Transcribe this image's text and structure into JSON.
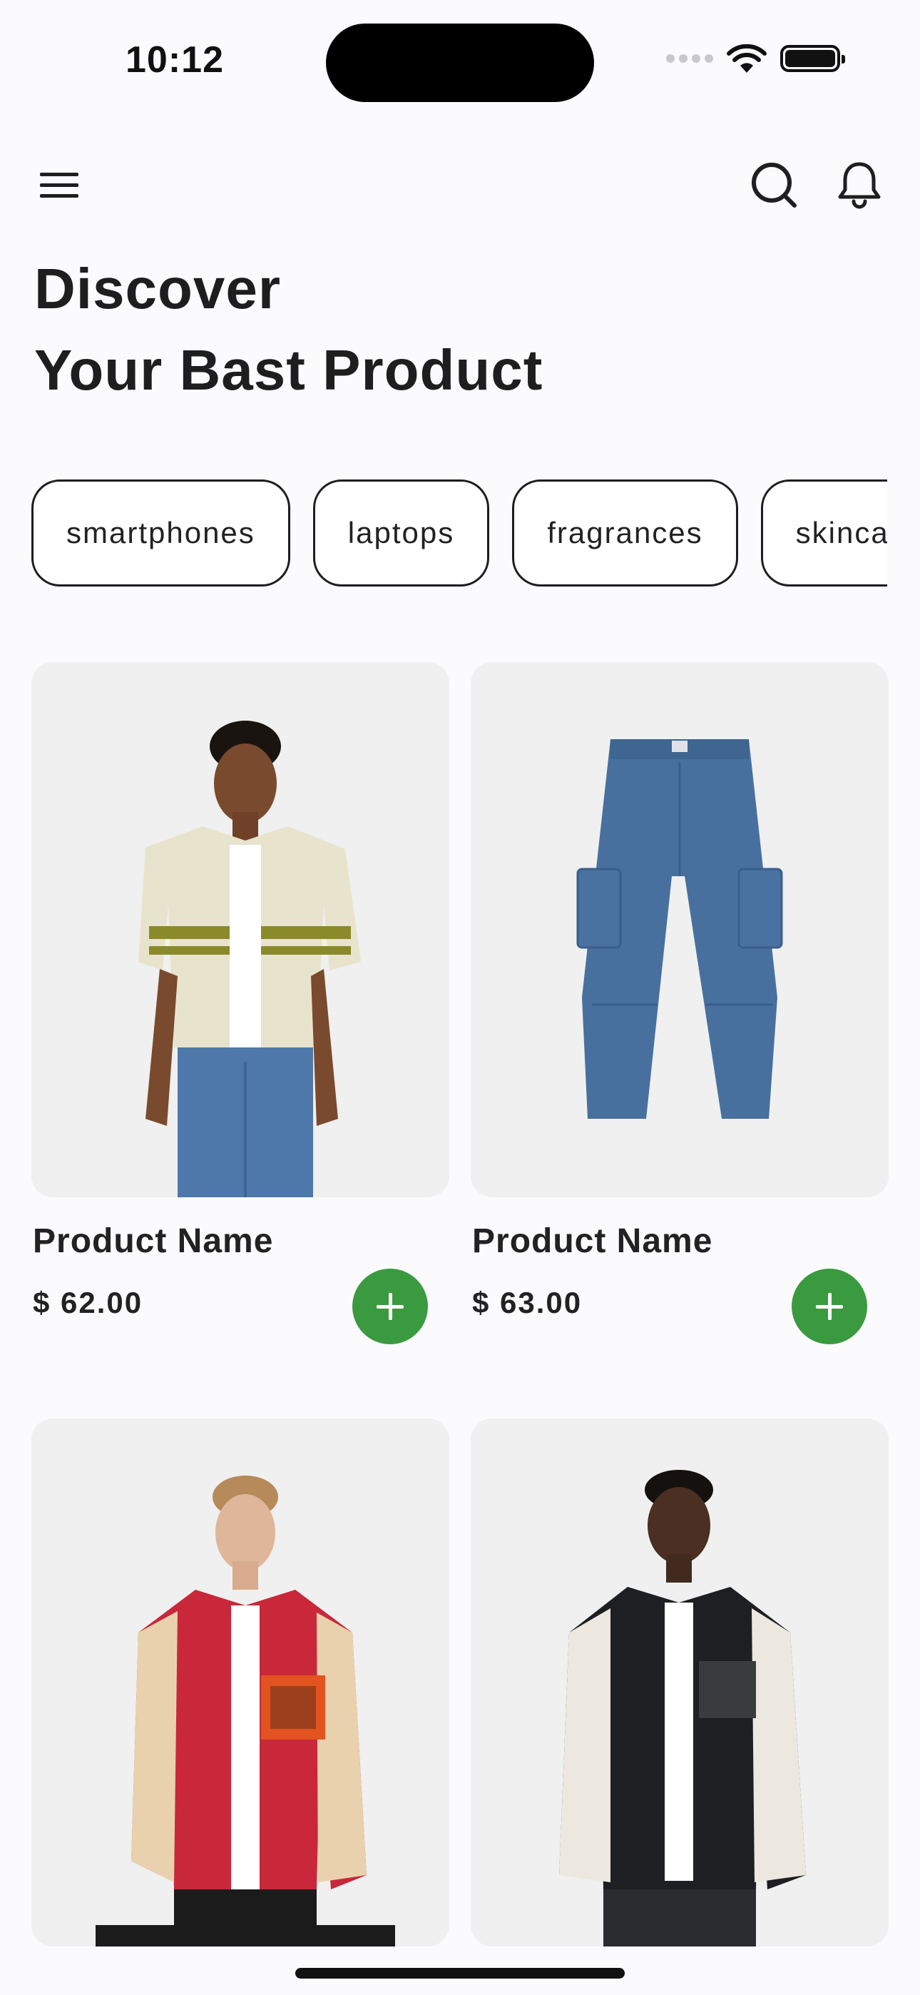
{
  "status_bar": {
    "time": "10:12"
  },
  "app_bar": {
    "menu_icon": "hamburger-menu-icon",
    "search_icon": "search-icon",
    "notification_icon": "bell-icon"
  },
  "heading": {
    "line1": "Discover",
    "line2": "Your Bast Product"
  },
  "categories": [
    "smartphones",
    "laptops",
    "fragrances",
    "skincare"
  ],
  "products": [
    {
      "name": "Product Name",
      "price": "$ 62.00",
      "image": "crochet-shirt-model"
    },
    {
      "name": "Product Name",
      "price": "$ 63.00",
      "image": "denim-cargo-jeans"
    },
    {
      "image": "red-varsity-jacket-model"
    },
    {
      "image": "black-varsity-jacket-model"
    }
  ],
  "colors": {
    "accent": "#3a9a3f",
    "card_bg": "#eff0ef",
    "text": "#1f1f1f"
  }
}
